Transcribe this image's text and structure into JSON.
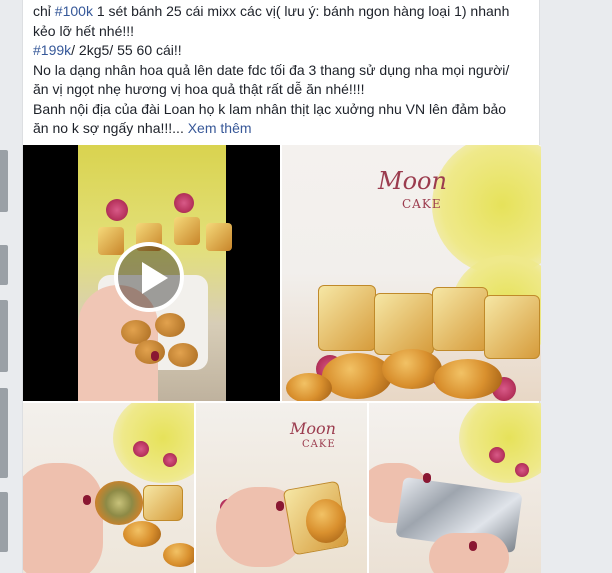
{
  "post": {
    "lines": {
      "line1_prefix": "chỉ ",
      "line1_tag": "#100k",
      "line1_rest": " 1 sét bánh 25 cái mixx các vị( lưu ý: bánh ngon hàng loại 1) nhanh",
      "line2": "kẻo lỡ hết nhé!!!",
      "line3_tag": "#199k",
      "line3_rest": "/ 2kg5/ 55 60 cái!!",
      "line4": "No la dạng nhân hoa quả lên date fdc tối đa 3 thang sử dụng nha mọi người/",
      "line5": "ăn vị ngọt nhẹ hương vị hoa quả thật rất dễ ăn nhé!!!!",
      "line6": "Banh nội địa của đài Loan họ k lam nhân thịt lạc xuởng nhu VN lên đảm bảo",
      "line7": "ăn no k sợ ngấy nha!!!...",
      "see_more": "Xem thêm"
    }
  },
  "media": {
    "logo_moon": "Moon",
    "logo_cake": "CAKE",
    "logo_small_moon": "Moon",
    "logo_small_cake": "CAKE",
    "play_icon": "play-icon"
  },
  "colors": {
    "link": "#385898",
    "hashtag": "#365899",
    "text": "#1d2129",
    "background": "#e9ebee",
    "card": "#ffffff"
  }
}
